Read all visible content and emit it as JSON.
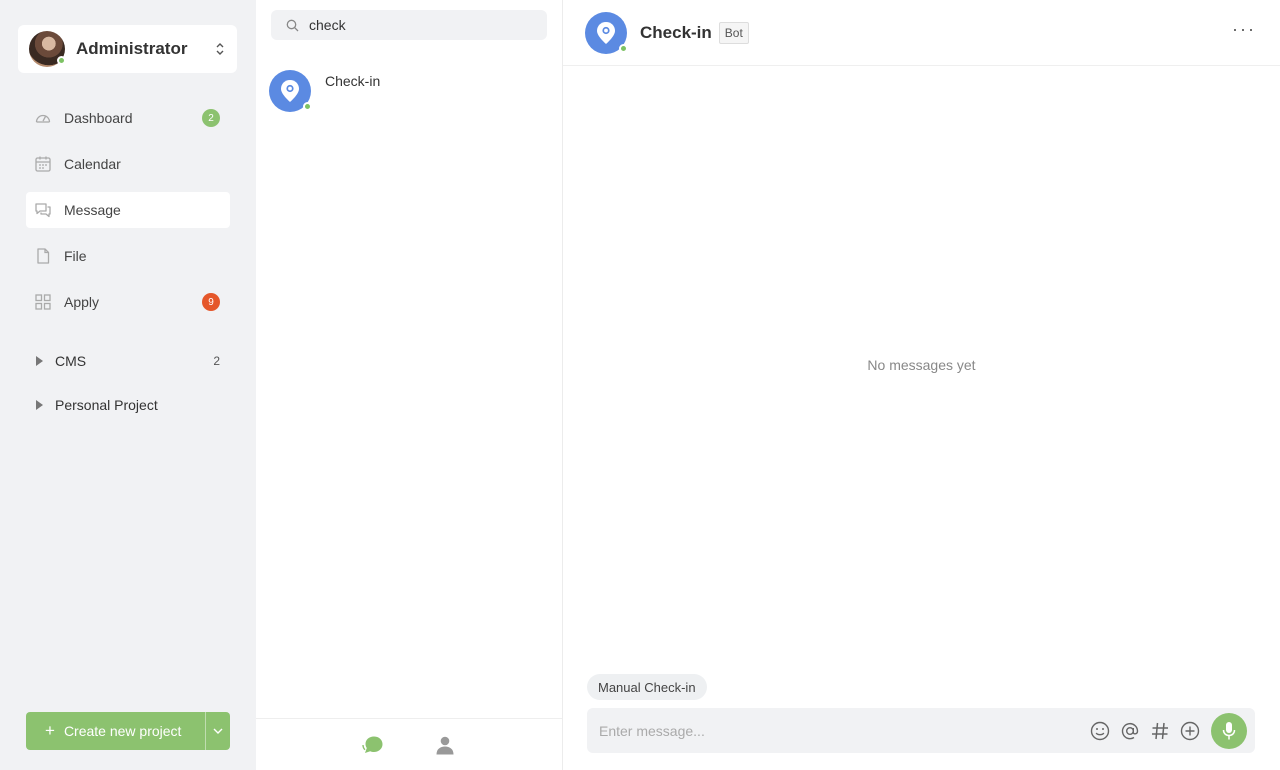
{
  "colors": {
    "accent_green": "#8cc26f",
    "badge_red": "#e5572a",
    "bot_blue": "#5b8ae2",
    "online": "#7dc264"
  },
  "user": {
    "name": "Administrator",
    "status": "online"
  },
  "nav": [
    {
      "label": "Dashboard",
      "icon": "dashboard-icon",
      "badge": "2"
    },
    {
      "label": "Calendar",
      "icon": "calendar-icon"
    },
    {
      "label": "Message",
      "icon": "message-icon",
      "active": true
    },
    {
      "label": "File",
      "icon": "file-icon"
    },
    {
      "label": "Apply",
      "icon": "apps-grid-icon",
      "badge": "9"
    }
  ],
  "groups": [
    {
      "label": "CMS",
      "count": "2"
    },
    {
      "label": "Personal Project"
    }
  ],
  "create_button": {
    "label": "Create new project"
  },
  "search": {
    "value": "check"
  },
  "conversations": [
    {
      "name": "Check-in",
      "status": "online"
    }
  ],
  "chat": {
    "title": "Check-in",
    "tag": "Bot",
    "empty_text": "No messages yet",
    "quick_action": "Manual Check-in",
    "input_placeholder": "Enter message..."
  }
}
